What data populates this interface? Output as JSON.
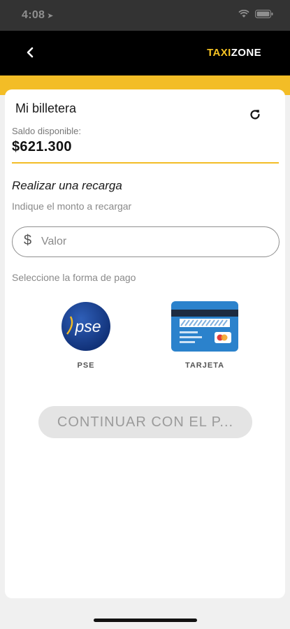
{
  "status_bar": {
    "time": "4:08",
    "location_icon": "location-arrow-icon",
    "wifi_icon": "wifi-icon",
    "battery_icon": "battery-icon"
  },
  "header": {
    "back_icon": "chevron-left-icon",
    "brand_part1": "TAXI",
    "brand_part2": "ZONE",
    "brand_accent": "#f6c324"
  },
  "wallet": {
    "title": "Mi billetera",
    "refresh_icon": "refresh-icon",
    "balance_label": "Saldo disponible:",
    "balance_value": "$621.300"
  },
  "recharge": {
    "title": "Realizar una recarga",
    "amount_hint": "Indique el monto a recargar",
    "currency_symbol": "$",
    "amount_placeholder": "Valor",
    "payment_hint": "Seleccione la forma de pago"
  },
  "payment_methods": [
    {
      "label": "PSE",
      "icon": "pse-logo-icon"
    },
    {
      "label": "TARJETA",
      "icon": "credit-card-icon"
    }
  ],
  "continue_button": "CONTINUAR CON EL P...",
  "colors": {
    "accent": "#f3bd26",
    "nav": "#000000",
    "status": "#333333"
  }
}
